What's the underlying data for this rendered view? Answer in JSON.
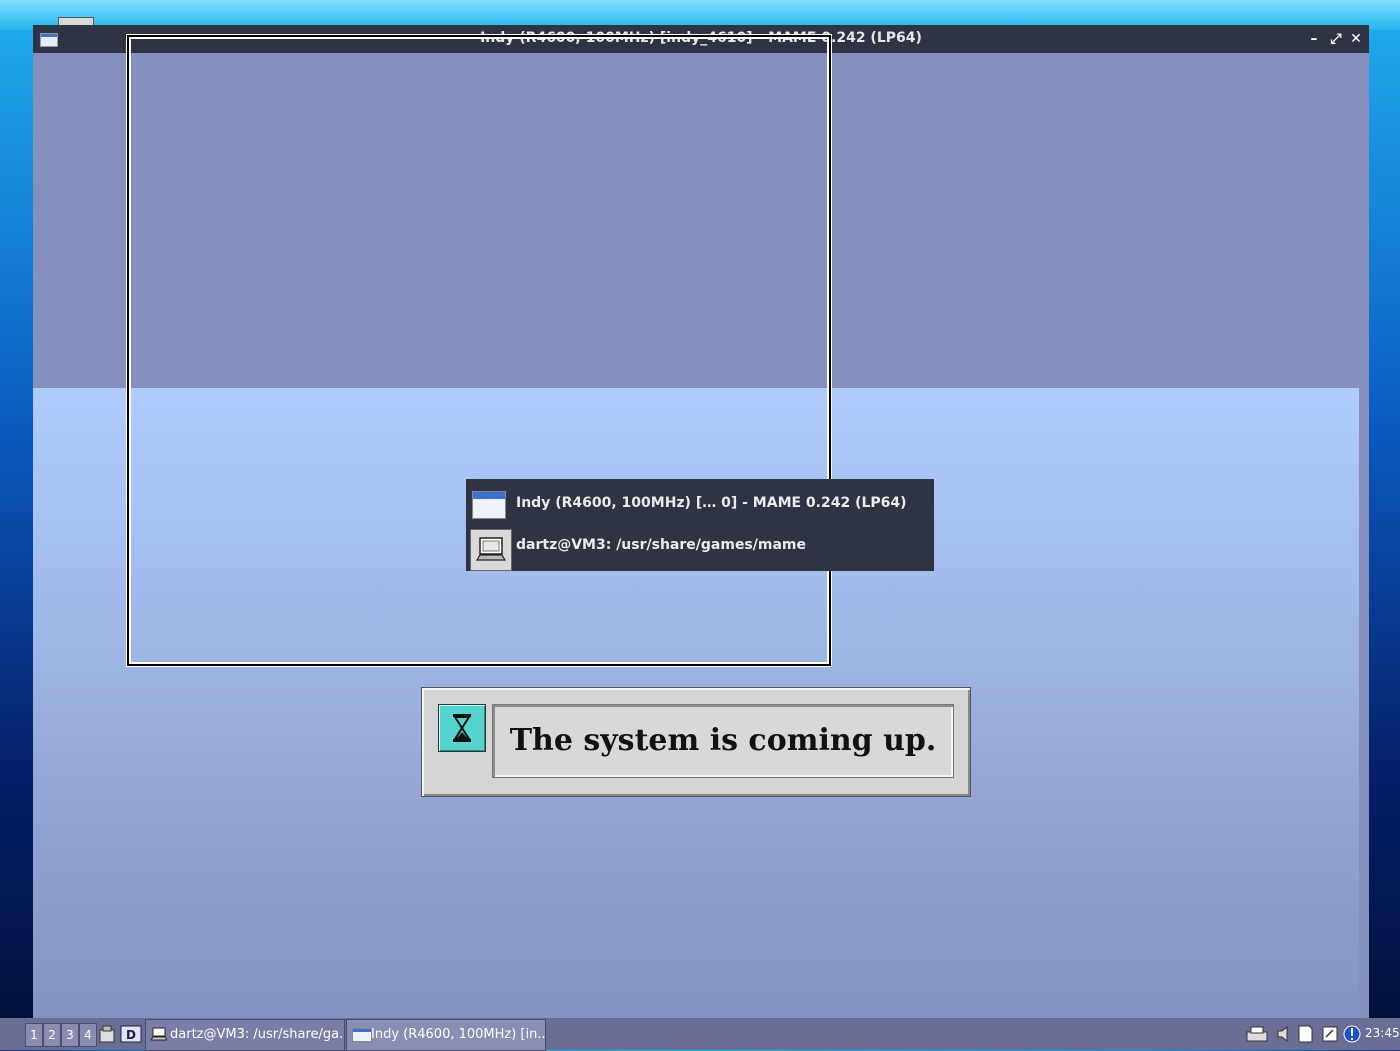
{
  "window": {
    "title": "Indy (R4600, 100MHz) [indy_4610] - MAME 0.242 (LP64)",
    "minimize": "–",
    "maximize": "⤢",
    "close": "✕"
  },
  "switcher": {
    "items": [
      {
        "label": "Indy (R4600, 100MHz) [… 0] - MAME 0.242 (LP64)",
        "icon": "window-icon"
      },
      {
        "label": "dartz@VM3: /usr/share/games/mame",
        "icon": "terminal-icon"
      }
    ]
  },
  "dialog": {
    "message": "The system is coming up.",
    "icon": "hourglass-icon"
  },
  "taskbar": {
    "workspaces": [
      "1",
      "2",
      "3",
      "4"
    ],
    "tasks": [
      {
        "label": "dartz@VM3: /usr/share/ga...",
        "icon": "terminal-icon"
      },
      {
        "label": "Indy (R4600, 100MHz) [in...",
        "icon": "window-icon"
      }
    ],
    "clock": "23:45"
  },
  "colors": {
    "titlebar": "#2f3444",
    "emu_top": "#8491bf",
    "hourglass_bg": "#57d3cf"
  }
}
